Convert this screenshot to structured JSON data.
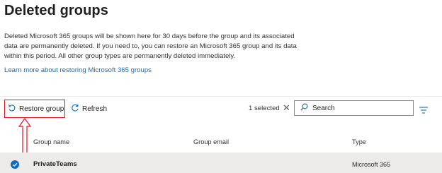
{
  "page": {
    "title": "Deleted groups",
    "description": "Deleted Microsoft 365 groups will be shown here for 30 days before the group and its associated data are permanently deleted. If you need to, you can restore an Microsoft 365 group and its data within this period. All other group types are permanently deleted immediately.",
    "learn_more": "Learn more about restoring Microsoft 365 groups"
  },
  "toolbar": {
    "restore_label": "Restore group",
    "refresh_label": "Refresh",
    "selected_count": "1 selected",
    "search_value": "Search",
    "icons": {
      "restore": "restore-icon",
      "refresh": "refresh-icon",
      "clear": "close-icon",
      "search": "search-icon",
      "filter": "filter-icon"
    }
  },
  "table": {
    "columns": [
      "Group name",
      "Group email",
      "Type"
    ],
    "rows": [
      {
        "name": "PrivateTeams",
        "email": "",
        "type": "Microsoft 365",
        "selected": true
      }
    ]
  },
  "colors": {
    "accent": "#0f6cbd",
    "highlight": "#e81123",
    "selected_row": "#edebe9"
  }
}
